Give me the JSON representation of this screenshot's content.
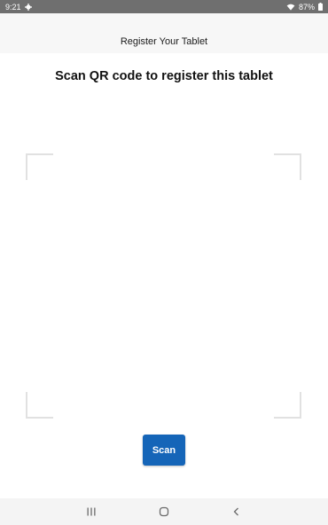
{
  "status_bar": {
    "time": "9:21",
    "battery": "87%",
    "icons": [
      "settings-gear-icon",
      "wifi-icon",
      "battery-icon"
    ]
  },
  "header": {
    "title": "Register Your Tablet"
  },
  "main": {
    "instruction": "Scan QR code to register this tablet",
    "scan_button_label": "Scan"
  },
  "nav_bar": {
    "buttons": [
      "recent-apps-icon",
      "home-icon",
      "back-icon"
    ]
  },
  "colors": {
    "accent": "#1565b8",
    "status_bar": "#6f6f6f",
    "header_bg": "#f7f7f7",
    "viewfinder_corner": "#e1e1e1"
  }
}
